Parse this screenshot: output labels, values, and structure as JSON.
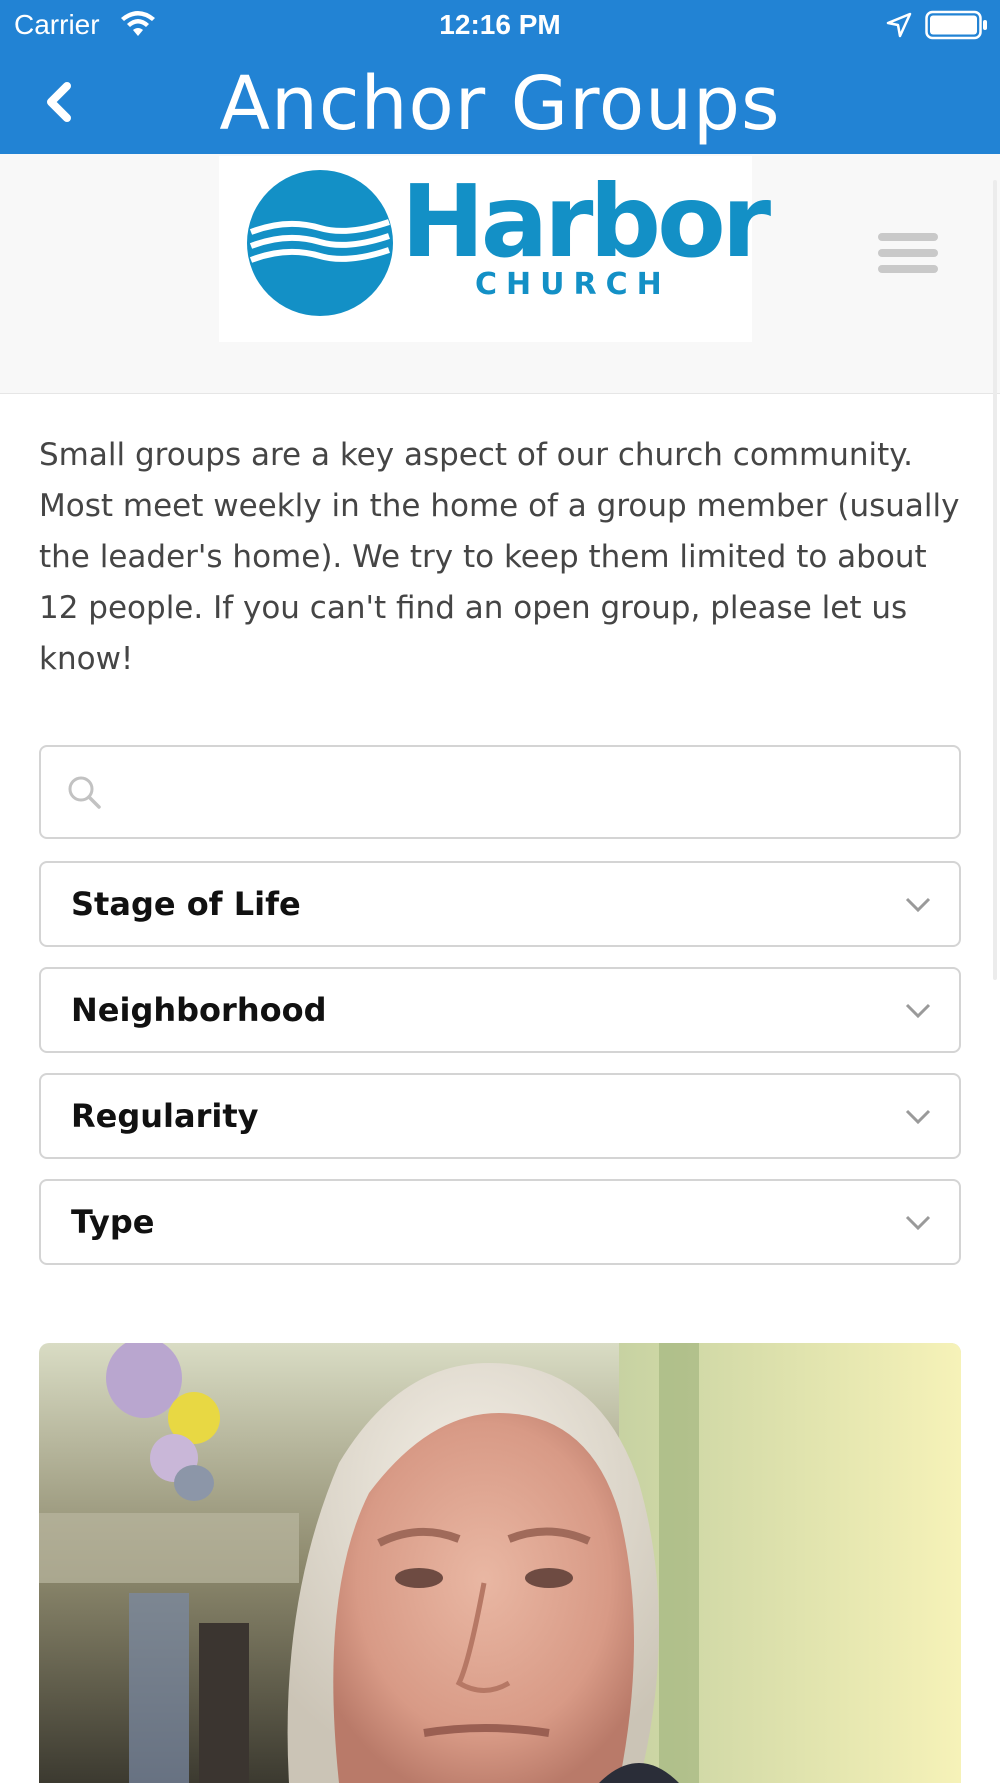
{
  "status_bar": {
    "carrier": "Carrier",
    "time": "12:16 PM"
  },
  "nav": {
    "title": "Anchor Groups"
  },
  "logo": {
    "word": "Harbor",
    "sub": "CHURCH",
    "color": "#1390c6"
  },
  "intro": {
    "text": "Small groups are a key aspect of our church community. Most meet weekly in the home of a group member (usually the leader's home). We try to keep them limited to about 12 people. If you can't find an open group, please let us know!"
  },
  "search": {
    "value": "",
    "placeholder": ""
  },
  "filters": [
    {
      "label": "Stage of Life"
    },
    {
      "label": "Neighborhood"
    },
    {
      "label": "Regularity"
    },
    {
      "label": "Type"
    }
  ],
  "colors": {
    "nav_background": "#2283d4",
    "border": "#d4d4d4"
  },
  "icons": {
    "wifi": "wifi-icon",
    "location": "location-arrow-icon",
    "battery": "battery-icon",
    "back": "chevron-left-icon",
    "menu": "hamburger-menu-icon",
    "search": "search-icon",
    "dropdown": "chevron-down-icon"
  }
}
